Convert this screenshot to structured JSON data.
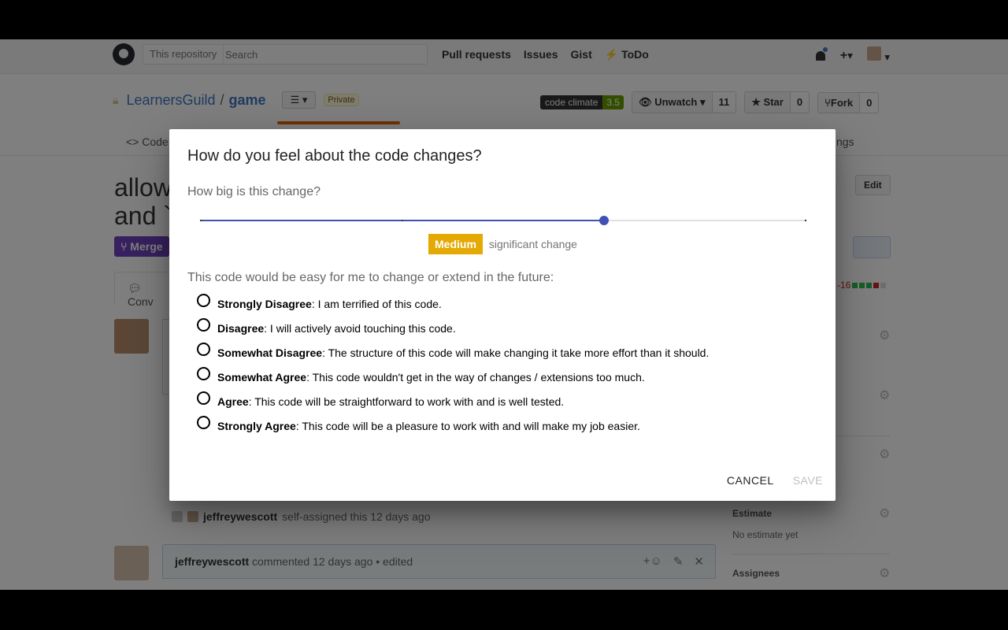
{
  "header": {
    "search_scope": "This repository",
    "search_placeholder": "Search",
    "nav": [
      "Pull requests",
      "Issues",
      "Gist",
      "ToDo"
    ],
    "plus": "+",
    "plus_caret": "▾",
    "avatar_caret": "▾"
  },
  "repo": {
    "owner": "LearnersGuild",
    "separator": "/",
    "name": "game",
    "list_button": "☰ ▾",
    "visibility": "Private",
    "code_climate_label": "code climate",
    "code_climate_score": "3.5",
    "watch_label": "Unwatch",
    "watch_count": "11",
    "star_label": "Star",
    "star_count": "0",
    "fork_label": "Fork",
    "fork_count": "0"
  },
  "tabs": {
    "code": "<> Code",
    "settings": "ngs"
  },
  "pr": {
    "title_line1": "allow",
    "title_line2": "and `",
    "merged": "Merge",
    "edit": "Edit",
    "conversation_tab": "Conv",
    "diffstat": "-16"
  },
  "timeline": {
    "event_user": "jeffreywescott",
    "event_text": "self-assigned this 12 days ago",
    "comment_user": "jeffreywescott",
    "comment_text": "commented 12 days ago • edited"
  },
  "sidebar": {
    "estimate_heading": "Estimate",
    "estimate_value": "No estimate yet",
    "assignees_heading": "Assignees"
  },
  "dialog": {
    "title": "How do you feel about the code changes?",
    "size_question": "How big is this change?",
    "slider": {
      "min": 0,
      "max": 3,
      "value": 2
    },
    "size_label": "Medium",
    "size_desc": "significant change",
    "ext_question": "This code would be easy for me to change or extend in the future:",
    "options": [
      {
        "label": "Strongly Disagree",
        "desc": ": I am terrified of this code."
      },
      {
        "label": "Disagree",
        "desc": ": I will actively avoid touching this code."
      },
      {
        "label": "Somewhat Disagree",
        "desc": ": The structure of this code will make changing it take more effort than it should."
      },
      {
        "label": "Somewhat Agree",
        "desc": ": This code wouldn't get in the way of changes / extensions too much."
      },
      {
        "label": "Agree",
        "desc": ": This code will be straightforward to work with and is well tested."
      },
      {
        "label": "Strongly Agree",
        "desc": ": This code will be a pleasure to work with and will make my job easier."
      }
    ],
    "cancel": "CANCEL",
    "save": "SAVE"
  },
  "colors": {
    "accent": "#3f51b5",
    "size_badge": "#e4a903",
    "merged": "#6f42c1"
  }
}
